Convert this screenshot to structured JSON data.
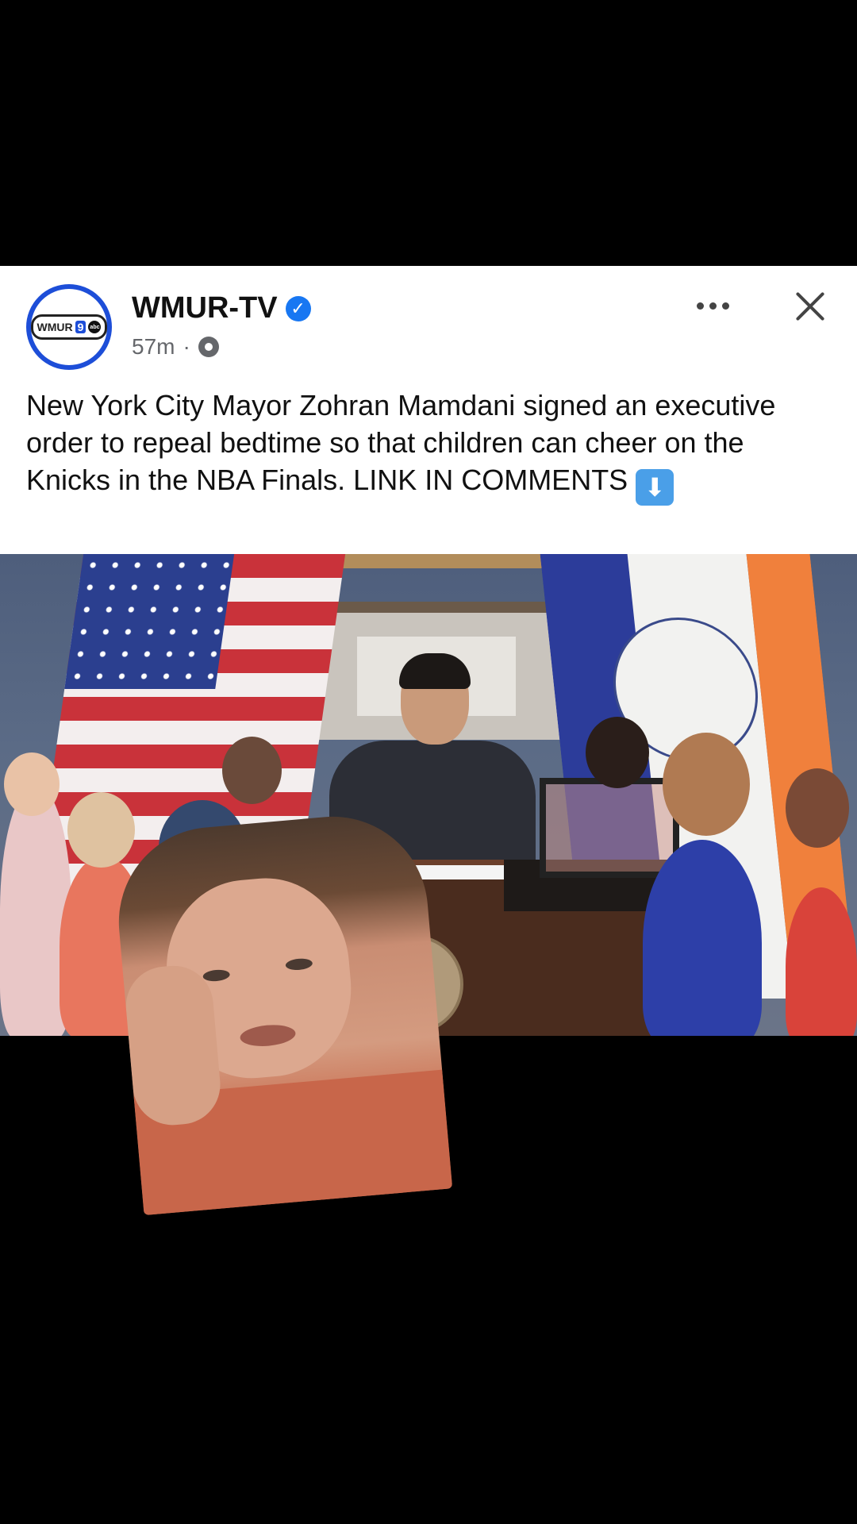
{
  "post": {
    "author": "WMUR-TV",
    "verified": true,
    "time": "57m",
    "separator": "·",
    "avatar_logo": {
      "text": "WMUR",
      "badge": "9",
      "network": "abc"
    },
    "caption_text": "New York City Mayor Zohran Mamdani signed an executive order to repeal bedtime so that children can cheer on the Knicks in the NBA Finals.  LINK IN COMMENTS",
    "caption_emoji": "⬇",
    "icons": {
      "verified": "verified-badge-icon",
      "audience": "gear-icon",
      "more": "more-options-icon",
      "close": "close-icon",
      "emoji": "down-arrow-emoji-icon"
    },
    "colors": {
      "verified_blue": "#1877f2",
      "avatar_ring": "#1d4ed8",
      "meta_gray": "#65676b"
    }
  }
}
